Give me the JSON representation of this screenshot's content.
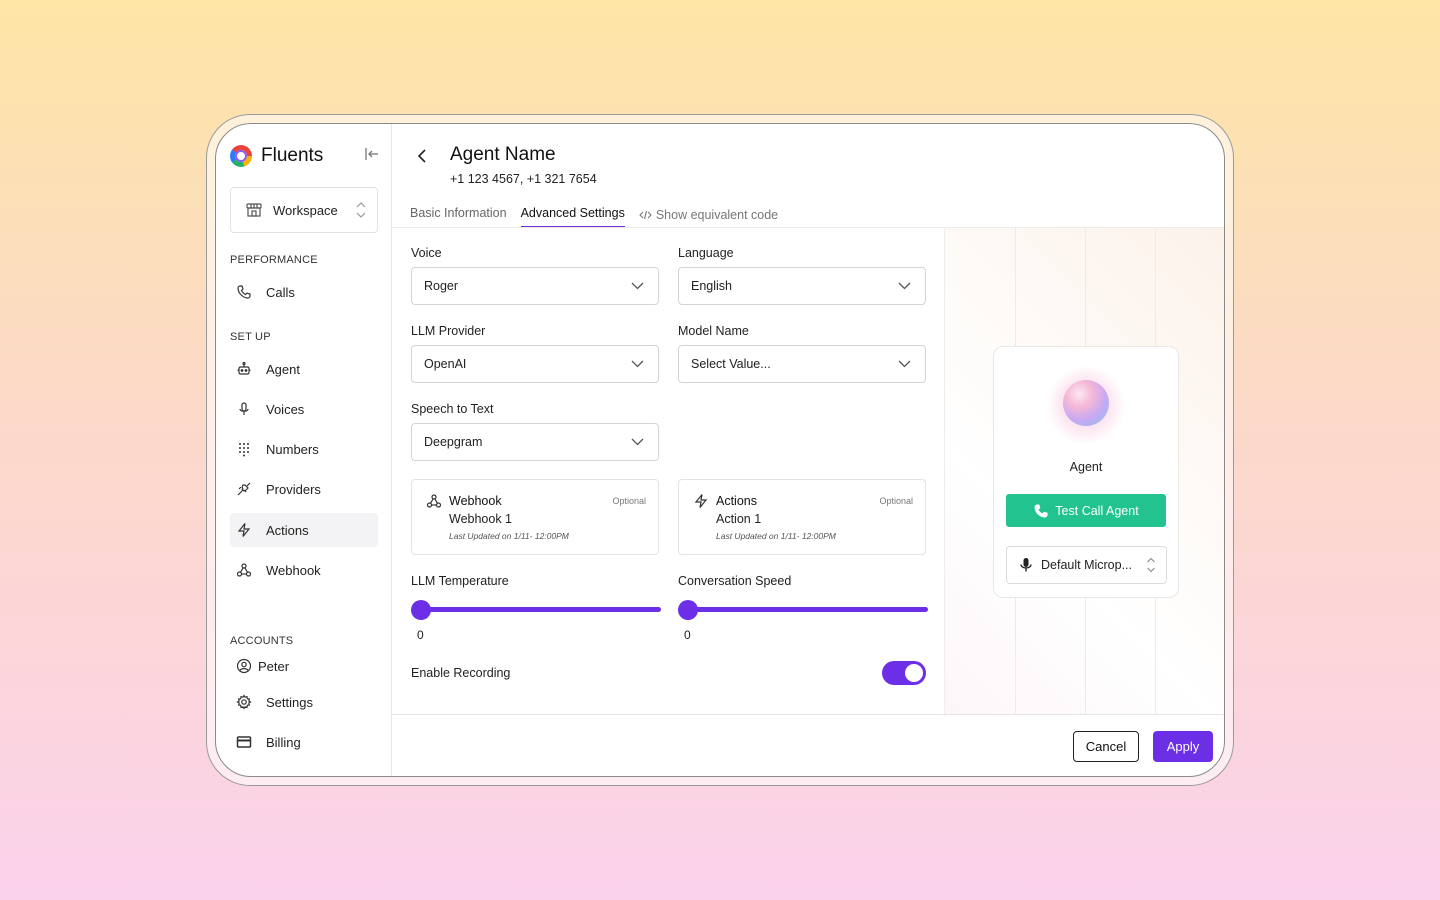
{
  "brand": {
    "name": "Fluents"
  },
  "workspace": {
    "label": "Workspace"
  },
  "sidebar": {
    "performance_title": "PERFORMANCE",
    "setup_title": "SET UP",
    "accounts_title": "ACCOUNTS",
    "items": [
      {
        "label": "Calls",
        "icon": "phone-icon"
      },
      {
        "label": "Agent",
        "icon": "robot-icon"
      },
      {
        "label": "Voices",
        "icon": "microphone-icon"
      },
      {
        "label": "Numbers",
        "icon": "dialpad-icon"
      },
      {
        "label": "Providers",
        "icon": "plug-icon"
      },
      {
        "label": "Actions",
        "icon": "lightning-icon",
        "active": true
      },
      {
        "label": "Webhook",
        "icon": "webhook-icon"
      },
      {
        "label": "Peter",
        "icon": "user-icon"
      },
      {
        "label": "Settings",
        "icon": "gear-icon"
      },
      {
        "label": "Billing",
        "icon": "credit-card-icon"
      }
    ]
  },
  "header": {
    "title": "Agent Name",
    "phones": "+1 123 4567, +1 321 7654"
  },
  "tabs": [
    {
      "label": "Basic Information"
    },
    {
      "label": "Advanced Settings",
      "active": true
    },
    {
      "label": "Show equivalent code"
    }
  ],
  "form": {
    "voice": {
      "label": "Voice",
      "value": "Roger"
    },
    "language": {
      "label": "Language",
      "value": "English"
    },
    "llm_provider": {
      "label": "LLM Provider",
      "value": "OpenAI"
    },
    "model_name": {
      "label": "Model Name",
      "value": "Select Value..."
    },
    "speech_to_text": {
      "label": "Speech to Text",
      "value": "Deepgram"
    },
    "webhook_card": {
      "title": "Webhook",
      "optional": "Optional",
      "value": "Webhook 1",
      "meta": "Last Updated on 1/11- 12:00PM"
    },
    "actions_card": {
      "title": "Actions",
      "optional": "Optional",
      "value": "Action 1",
      "meta": "Last Updated on 1/11- 12:00PM"
    },
    "llm_temperature": {
      "label": "LLM Temperature",
      "value": "0"
    },
    "conversation_speed": {
      "label": "Conversation Speed",
      "value": "0"
    },
    "enable_recording": {
      "label": "Enable Recording",
      "on": true
    }
  },
  "preview": {
    "agent_label": "Agent",
    "test_button": "Test Call Agent",
    "microphone": "Default Microp..."
  },
  "footer": {
    "cancel": "Cancel",
    "apply": "Apply"
  },
  "colors": {
    "accent": "#6d2ee8",
    "success": "#22c38e"
  }
}
